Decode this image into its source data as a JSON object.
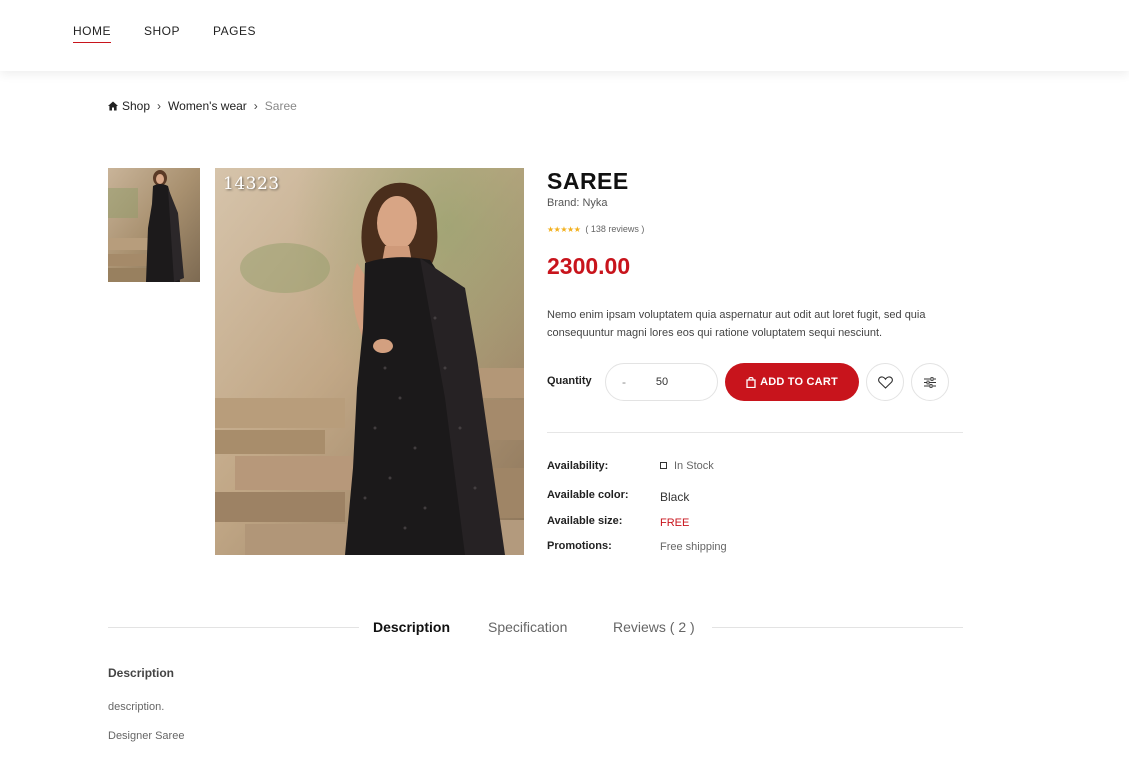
{
  "nav": {
    "items": [
      {
        "label": "HOME",
        "active": true
      },
      {
        "label": "SHOP",
        "active": false
      },
      {
        "label": "PAGES",
        "active": false
      }
    ]
  },
  "breadcrumb": {
    "home_icon": "home-icon",
    "items": [
      "Shop",
      "Women's wear",
      "Saree"
    ]
  },
  "gallery": {
    "image_code": "14323"
  },
  "product": {
    "title": "SAREE",
    "brand": "Brand: Nyka",
    "rating_stars": 5,
    "reviews": "( 138 reviews )",
    "price": "2300.00",
    "description": "Nemo enim ipsam voluptatem quia aspernatur aut odit aut loret fugit, sed quia consequuntur magni lores eos qui ratione voluptatem sequi nesciunt."
  },
  "purchase": {
    "quantity_label": "Quantity",
    "minus_label": "-",
    "quantity_value": "50",
    "add_to_cart_label": "ADD TO CART",
    "cart_icon": "shopping-bag-icon",
    "wishlist_icon": "heart-icon",
    "compare_icon": "sliders-icon"
  },
  "meta": {
    "availability_label": "Availability:",
    "availability_value": "In Stock",
    "color_label": "Available color:",
    "color_value": "Black",
    "size_label": "Available size:",
    "size_value": "FREE",
    "promo_label": "Promotions:",
    "promo_value": "Free shipping"
  },
  "tabs": {
    "description": "Description",
    "specification": "Specification",
    "reviews": "Reviews ( 2 )"
  },
  "description_section": {
    "title": "Description",
    "line1": "description.",
    "line2": "Designer Saree"
  },
  "colors": {
    "accent": "#c8141c",
    "star": "#f2b01e"
  }
}
